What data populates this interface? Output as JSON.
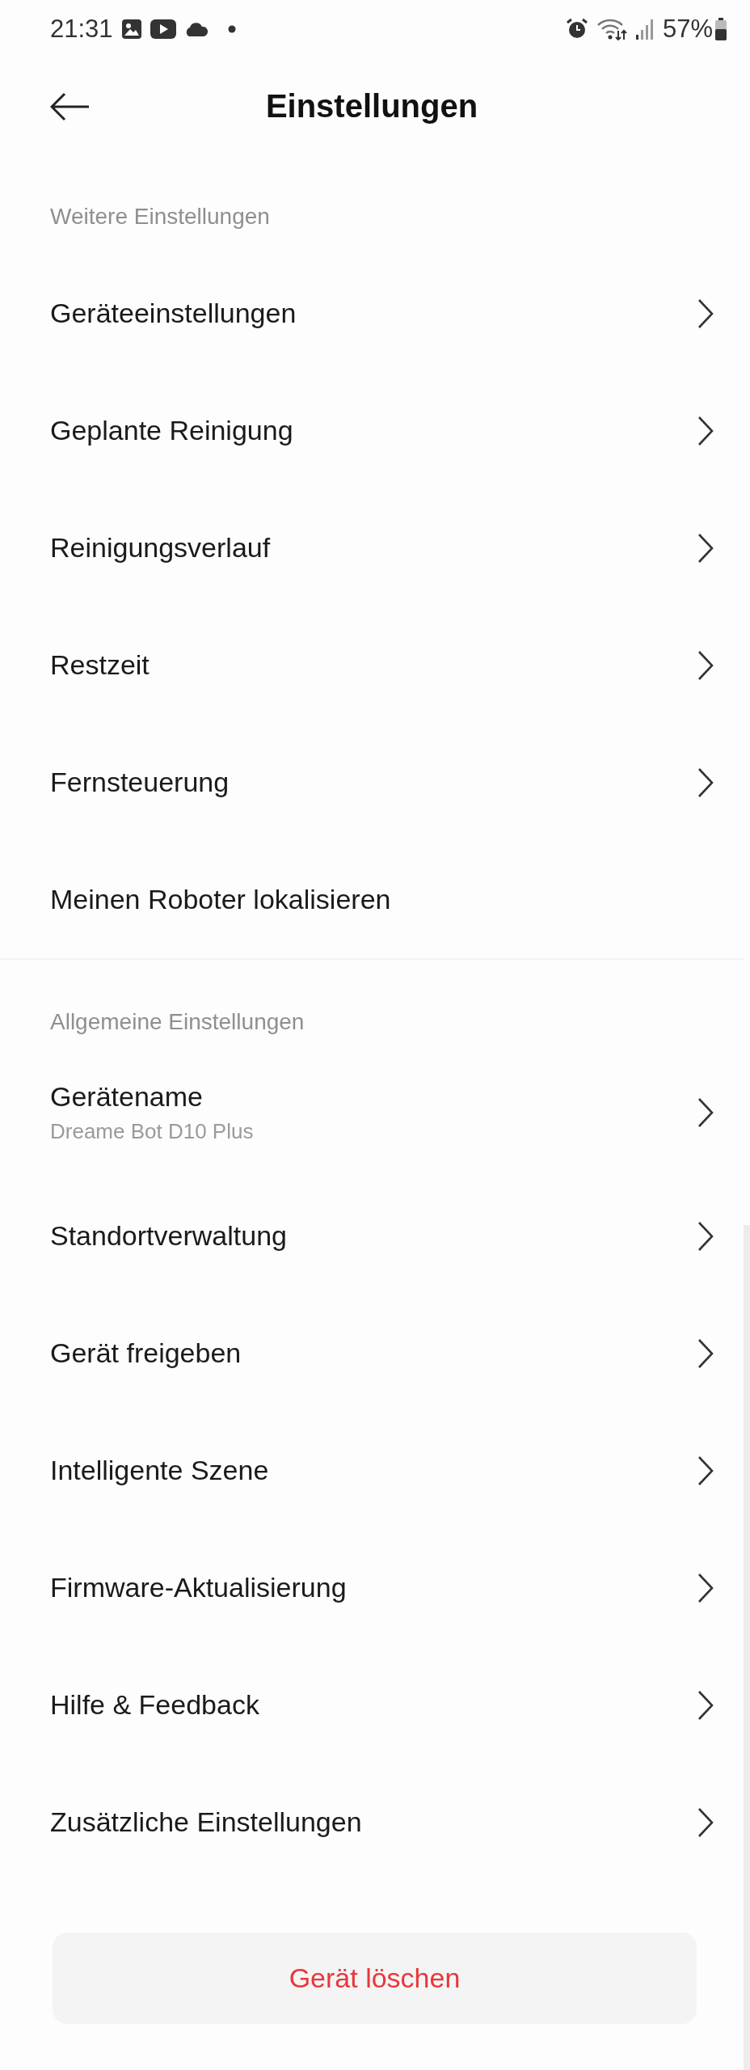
{
  "status_bar": {
    "time": "21:31",
    "battery": "57%"
  },
  "header": {
    "title": "Einstellungen"
  },
  "sections": [
    {
      "title": "Weitere Einstellungen",
      "items": [
        {
          "label": "Geräteeinstellungen",
          "chevron": true
        },
        {
          "label": "Geplante Reinigung",
          "chevron": true
        },
        {
          "label": "Reinigungsverlauf",
          "chevron": true
        },
        {
          "label": "Restzeit",
          "chevron": true
        },
        {
          "label": "Fernsteuerung",
          "chevron": true
        },
        {
          "label": "Meinen Roboter lokalisieren",
          "chevron": false
        }
      ]
    },
    {
      "title": "Allgemeine Einstellungen",
      "items": [
        {
          "label": "Gerätename",
          "subtitle": "Dreame Bot D10 Plus",
          "chevron": true
        },
        {
          "label": "Standortverwaltung",
          "chevron": true
        },
        {
          "label": "Gerät freigeben",
          "chevron": true
        },
        {
          "label": "Intelligente Szene",
          "chevron": true
        },
        {
          "label": "Firmware-Aktualisierung",
          "chevron": true
        },
        {
          "label": "Hilfe & Feedback",
          "chevron": true
        },
        {
          "label": "Zusätzliche Einstellungen",
          "chevron": true
        }
      ]
    }
  ],
  "delete_button": "Gerät löschen"
}
